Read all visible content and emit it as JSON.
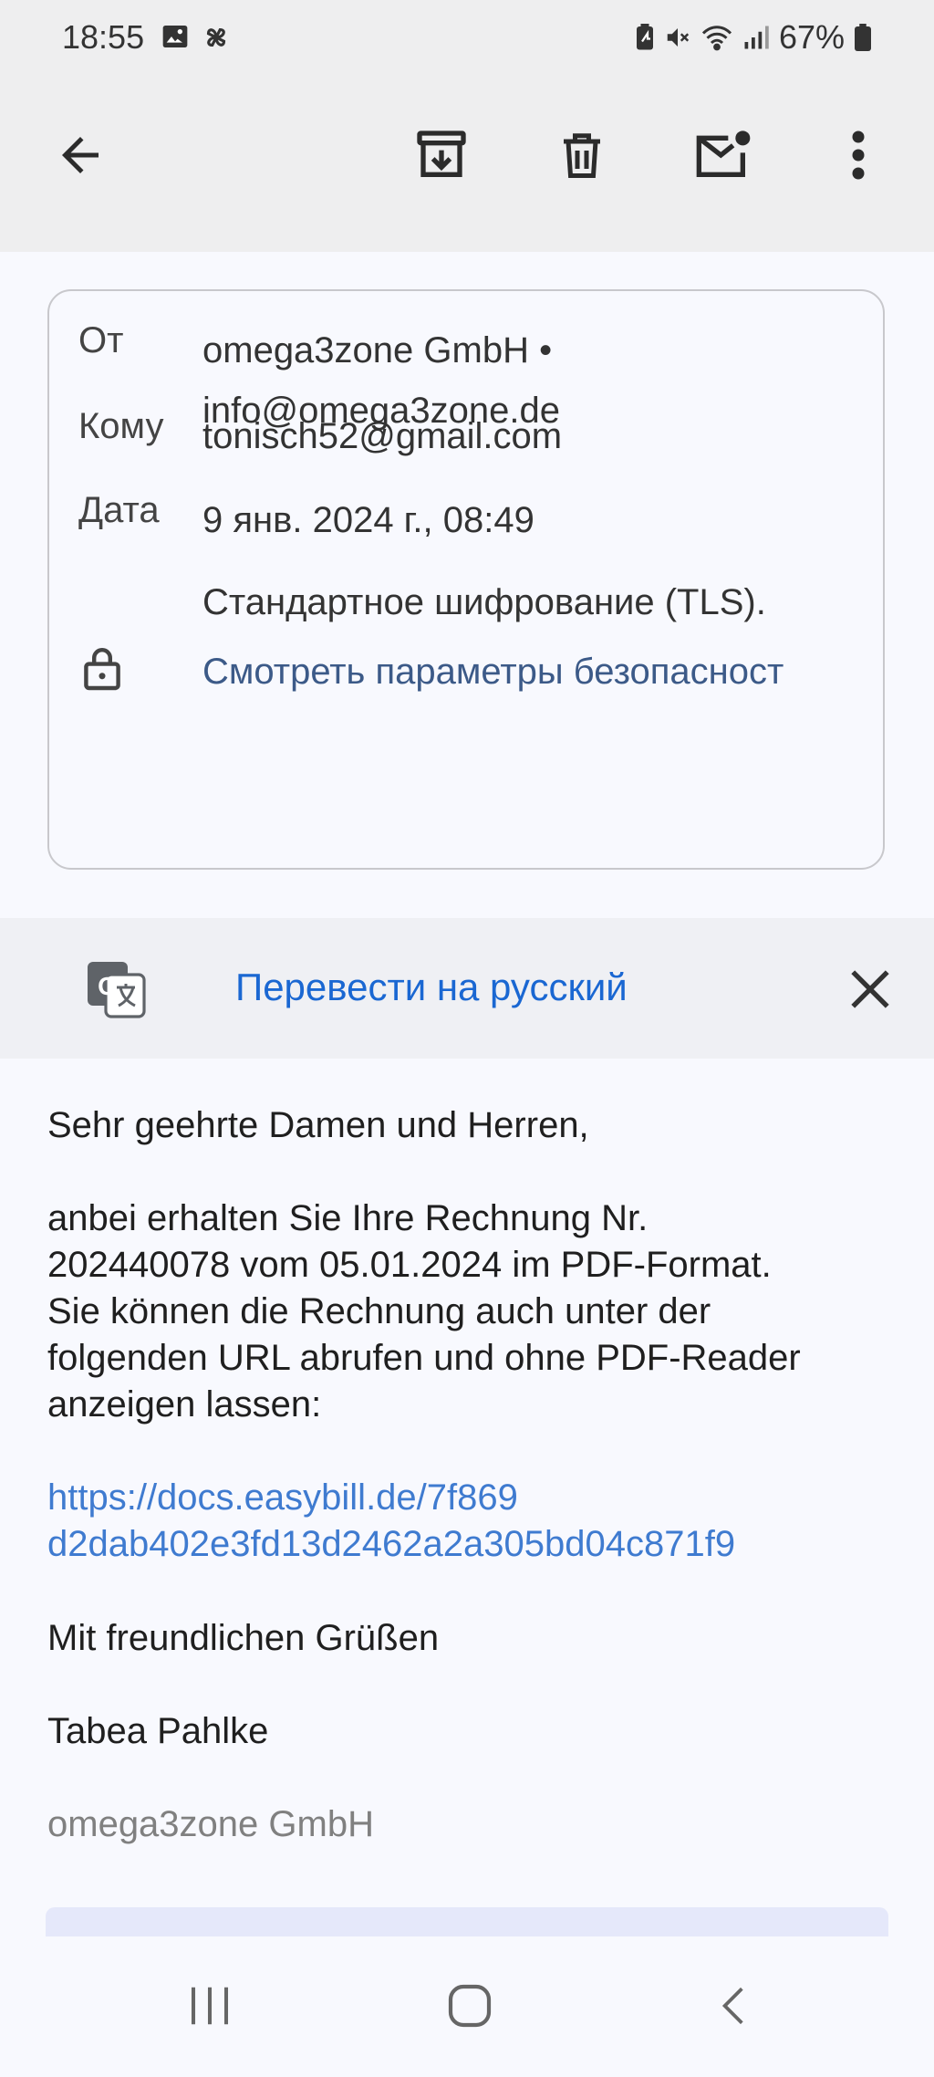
{
  "status_bar": {
    "time": "18:55",
    "battery": "67%",
    "icons": [
      "image-icon",
      "pinwheel-icon",
      "battery-saver-icon",
      "mute-icon",
      "wifi-icon",
      "signal-icon",
      "battery-icon"
    ]
  },
  "toolbar": {
    "icons": [
      "back-arrow-icon",
      "archive-icon",
      "trash-icon",
      "mark-unread-icon",
      "more-vert-icon"
    ]
  },
  "details": {
    "from_label": "От",
    "from_name": "omega3zone GmbH •",
    "from_email": "info@omega3zone.de",
    "to_label": "Кому",
    "to_value": "tonisch52@gmail.com",
    "date_label": "Дата",
    "date_value": "9 янв. 2024 г., 08:49",
    "encryption_text": "Стандартное шифрование (TLS).",
    "security_link": "Смотреть параметры безопасност"
  },
  "translate": {
    "label": "Перевести на русский"
  },
  "message": {
    "greeting": "Sehr geehrte Damen und Herren,",
    "line1": "anbei erhalten Sie Ihre Rechnung Nr.",
    "line2": "202440078 vom 05.01.2024 im PDF-Format.",
    "line3": "Sie können die Rechnung auch unter der",
    "line4": "folgenden URL abrufen und ohne PDF-Reader",
    "line5": "anzeigen lassen:",
    "link_line1": "https://docs.easybill.de/7f869",
    "link_line2": "d2dab402e3fd13d2462a2a305bd04c871f9",
    "closing": "Mit freundlichen Grüßen",
    "signer": "Tabea Pahlke",
    "company": "omega3zone GmbH"
  },
  "nav_bar": {
    "icons": [
      "recents-icon",
      "home-icon",
      "back-icon"
    ]
  }
}
